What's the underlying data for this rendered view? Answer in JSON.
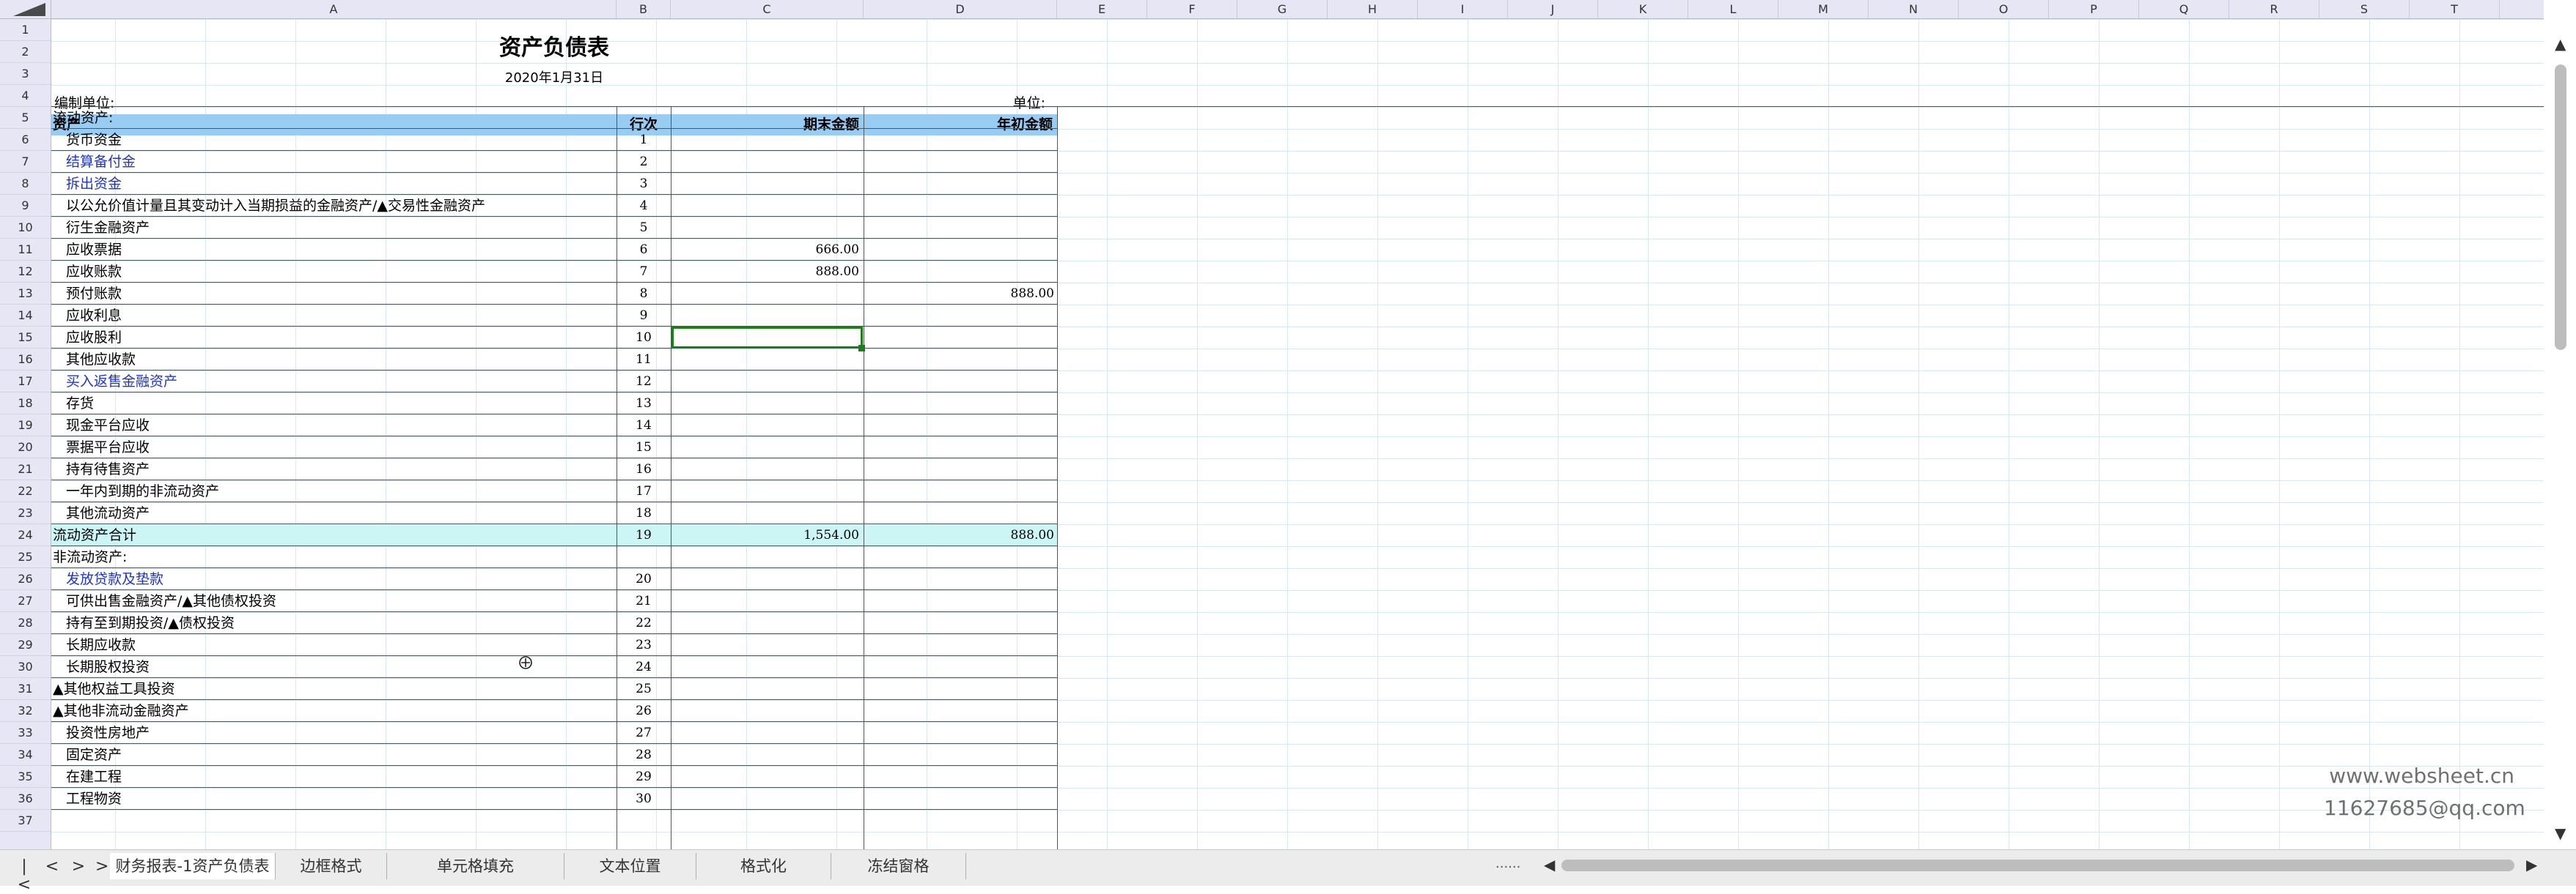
{
  "columns": [
    "A",
    "B",
    "C",
    "D",
    "E",
    "F",
    "G",
    "H",
    "I",
    "J",
    "K",
    "L",
    "M",
    "N",
    "O",
    "P",
    "Q",
    "R",
    "S",
    "T"
  ],
  "report": {
    "title": "资产负债表",
    "date": "2020年1月31日",
    "unit_left": "编制单位:",
    "unit_right": "单位:",
    "header": {
      "col_a": "资产",
      "col_b": "行次",
      "col_c": "期末金额",
      "col_d": "年初金额"
    }
  },
  "rows": [
    {
      "r": "5",
      "a": "流动资产:",
      "b": "",
      "c": "",
      "d": "",
      "indent": false
    },
    {
      "r": "6",
      "a": "货币资金",
      "b": "1",
      "c": "",
      "d": "",
      "indent": true
    },
    {
      "r": "7",
      "a": "结算备付金",
      "b": "2",
      "c": "",
      "d": "",
      "indent": true,
      "link": true
    },
    {
      "r": "8",
      "a": "拆出资金",
      "b": "3",
      "c": "",
      "d": "",
      "indent": true,
      "link": true
    },
    {
      "r": "9",
      "a": "以公允价值计量且其变动计入当期损益的金融资产/▲交易性金融资产",
      "b": "4",
      "c": "",
      "d": "",
      "indent": true
    },
    {
      "r": "10",
      "a": "衍生金融资产",
      "b": "5",
      "c": "",
      "d": "",
      "indent": true
    },
    {
      "r": "11",
      "a": "应收票据",
      "b": "6",
      "c": "666.00",
      "d": "",
      "indent": true
    },
    {
      "r": "12",
      "a": "应收账款",
      "b": "7",
      "c": "888.00",
      "d": "",
      "indent": true
    },
    {
      "r": "13",
      "a": "预付账款",
      "b": "8",
      "c": "",
      "d": "888.00",
      "indent": true
    },
    {
      "r": "14",
      "a": "应收利息",
      "b": "9",
      "c": "",
      "d": "",
      "indent": true
    },
    {
      "r": "15",
      "a": "应收股利",
      "b": "10",
      "c": "",
      "d": "",
      "indent": true
    },
    {
      "r": "16",
      "a": "其他应收款",
      "b": "11",
      "c": "",
      "d": "",
      "indent": true
    },
    {
      "r": "17",
      "a": "买入返售金融资产",
      "b": "12",
      "c": "",
      "d": "",
      "indent": true,
      "link": true
    },
    {
      "r": "18",
      "a": "存货",
      "b": "13",
      "c": "",
      "d": "",
      "indent": true
    },
    {
      "r": "19",
      "a": "现金平台应收",
      "b": "14",
      "c": "",
      "d": "",
      "indent": true
    },
    {
      "r": "20",
      "a": "票据平台应收",
      "b": "15",
      "c": "",
      "d": "",
      "indent": true
    },
    {
      "r": "21",
      "a": "持有待售资产",
      "b": "16",
      "c": "",
      "d": "",
      "indent": true
    },
    {
      "r": "22",
      "a": "一年内到期的非流动资产",
      "b": "17",
      "c": "",
      "d": "",
      "indent": true
    },
    {
      "r": "23",
      "a": "其他流动资产",
      "b": "18",
      "c": "",
      "d": "",
      "indent": true
    },
    {
      "r": "24",
      "a": "流动资产合计",
      "b": "19",
      "c": "1,554.00",
      "d": "888.00",
      "indent": false,
      "total": true
    },
    {
      "r": "25",
      "a": "非流动资产:",
      "b": "",
      "c": "",
      "d": "",
      "indent": false
    },
    {
      "r": "26",
      "a": "发放贷款及垫款",
      "b": "20",
      "c": "",
      "d": "",
      "indent": true,
      "link": true
    },
    {
      "r": "27",
      "a": "可供出售金融资产/▲其他债权投资",
      "b": "21",
      "c": "",
      "d": "",
      "indent": true
    },
    {
      "r": "28",
      "a": "持有至到期投资/▲债权投资",
      "b": "22",
      "c": "",
      "d": "",
      "indent": true
    },
    {
      "r": "29",
      "a": "长期应收款",
      "b": "23",
      "c": "",
      "d": "",
      "indent": true
    },
    {
      "r": "30",
      "a": "长期股权投资",
      "b": "24",
      "c": "",
      "d": "",
      "indent": true
    },
    {
      "r": "31",
      "a": "▲其他权益工具投资",
      "b": "25",
      "c": "",
      "d": "",
      "indent": false
    },
    {
      "r": "32",
      "a": "▲其他非流动金融资产",
      "b": "26",
      "c": "",
      "d": "",
      "indent": false
    },
    {
      "r": "33",
      "a": "投资性房地产",
      "b": "27",
      "c": "",
      "d": "",
      "indent": true
    },
    {
      "r": "34",
      "a": "固定资产",
      "b": "28",
      "c": "",
      "d": "",
      "indent": true
    },
    {
      "r": "35",
      "a": "在建工程",
      "b": "29",
      "c": "",
      "d": "",
      "indent": true
    },
    {
      "r": "36",
      "a": "工程物资",
      "b": "30",
      "c": "",
      "d": "",
      "indent": true
    }
  ],
  "row_numbers": [
    "1",
    "2",
    "3",
    "4",
    "5",
    "6",
    "7",
    "8",
    "9",
    "10",
    "11",
    "12",
    "13",
    "14",
    "15",
    "16",
    "17",
    "18",
    "19",
    "20",
    "21",
    "22",
    "23",
    "24",
    "25",
    "26",
    "27",
    "28",
    "29",
    "30",
    "31",
    "32",
    "33",
    "34",
    "35",
    "36",
    "37"
  ],
  "watermark": {
    "line1": "www.websheet.cn",
    "line2": "11627685@qq.com"
  },
  "tabs": [
    {
      "label": "财务报表-1资产负债表",
      "active": true
    },
    {
      "label": "边框格式",
      "active": false
    },
    {
      "label": "单元格填充",
      "active": false
    },
    {
      "label": "文本位置",
      "active": false
    },
    {
      "label": "格式化",
      "active": false
    },
    {
      "label": "冻结窗格",
      "active": false
    }
  ],
  "tab_nav": {
    "first": "|<",
    "prev": "<",
    "next": ">",
    "last": ">|"
  },
  "tab_dots": "......",
  "colors": {
    "header_fill": "#99ccf2",
    "total_fill": "#ccf5f5",
    "link": "#1f35c8",
    "selection": "#1d7a1d"
  }
}
